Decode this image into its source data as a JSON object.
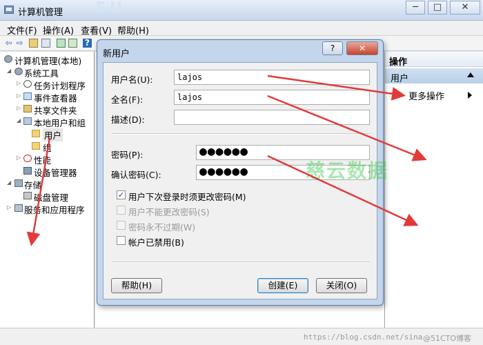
{
  "window": {
    "title": "计算机管理",
    "watermark_text": "FU",
    "minimize": "─",
    "maximize": "□",
    "close": "✕"
  },
  "menu": [
    "文件(F)",
    "操作(A)",
    "查看(V)",
    "帮助(H)"
  ],
  "toolbar": {
    "icons": [
      "back-arrow-icon",
      "forward-arrow-icon",
      "up-folder-icon",
      "show-tree-icon",
      "refresh-icon",
      "export-icon",
      "help-icon"
    ],
    "back": "⇦",
    "forward": "⇨",
    "help": "?"
  },
  "tree": {
    "root": "计算机管理(本地)",
    "system_tools": "系统工具",
    "task_scheduler": "任务计划程序",
    "event_viewer": "事件查看器",
    "shared_folders": "共享文件夹",
    "local_users": "本地用户和组",
    "users": "用户",
    "groups": "组",
    "performance": "性能",
    "device_manager": "设备管理器",
    "storage": "存储",
    "disk_management": "磁盘管理",
    "services": "服务和应用程序"
  },
  "actions": {
    "header": "操作",
    "section": "用户",
    "more": "更多操作"
  },
  "dialog": {
    "title": "新用户",
    "help_btn": "?",
    "close_btn": "✕",
    "username_label": "用户名(U):",
    "username_value": "lajos",
    "fullname_label": "全名(F):",
    "fullname_value": "lajos",
    "description_label": "描述(D):",
    "description_value": "",
    "password_label": "密码(P):",
    "password_value": "●●●●●●",
    "confirm_label": "确认密码(C):",
    "confirm_value": "●●●●●●",
    "options": [
      {
        "label": "用户下次登录时须更改密码(M)",
        "checked": true,
        "enabled": true
      },
      {
        "label": "用户不能更改密码(S)",
        "checked": false,
        "enabled": false
      },
      {
        "label": "密码永不过期(W)",
        "checked": false,
        "enabled": false
      },
      {
        "label": "帐户已禁用(B)",
        "checked": false,
        "enabled": true
      }
    ],
    "check_mark": "✓",
    "help_button": "帮助(H)",
    "create_button": "创建(E)",
    "close_button": "关闭(O)"
  },
  "watermarks": {
    "cloud": "慈云数据",
    "url": "https://blog.csdn.net/sina",
    "site": "@51CTO博客"
  },
  "colors": {
    "annotation_arrow": "#e23a3a",
    "selection": "#cfe0f2"
  }
}
